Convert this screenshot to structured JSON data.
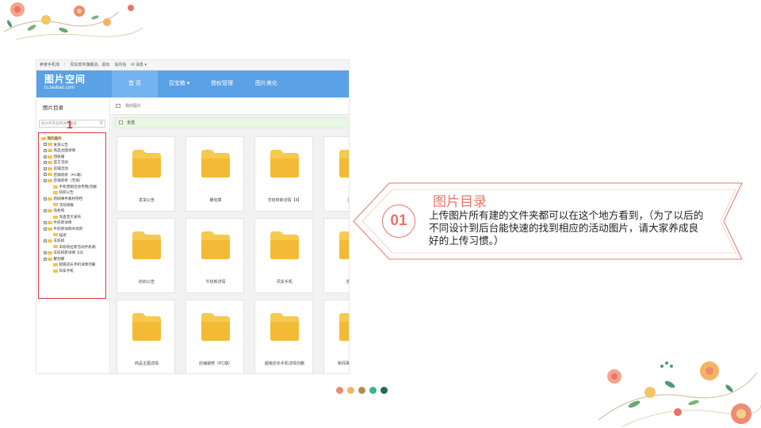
{
  "topbar": {
    "link1": "卖家手机淘",
    "link2": "风车软件旗舰店，退出",
    "link3": "站内信",
    "message": "消息"
  },
  "navbar": {
    "logo_main": "图片空间",
    "logo_sub": "tu.taobao.com",
    "items": [
      "首 页",
      "百宝箱 ▾",
      "授权管理",
      "图片美化"
    ]
  },
  "sidebar": {
    "title": "图片目录",
    "search_placeholder": "按文件夹名称进行搜索",
    "callout_number": "1",
    "tree": [
      {
        "label": "我的图片",
        "level": "root"
      },
      {
        "label": "发货公告",
        "level": "lvl1",
        "expand": true
      },
      {
        "label": "商品主图详情",
        "level": "lvl1",
        "expand": true
      },
      {
        "label": "回收箱",
        "level": "lvl1",
        "expand": true
      },
      {
        "label": "官方活动",
        "level": "lvl1",
        "expand": true
      },
      {
        "label": "店铺活动",
        "level": "lvl1",
        "expand": true
      },
      {
        "label": "店铺装修（PC端）",
        "level": "lvl1",
        "expand": true
      },
      {
        "label": "店铺装修（无线）",
        "level": "lvl1",
        "expand": true
      },
      {
        "label": "手机营销活动专用(勿删",
        "level": "lvl2"
      },
      {
        "label": "纺织公告",
        "level": "lvl2"
      },
      {
        "label": "新闻事件素材存档",
        "level": "lvl1",
        "expand": true
      },
      {
        "label": "活动海报",
        "level": "lvl2"
      },
      {
        "label": "淘抢购",
        "level": "lvl1",
        "expand": true
      },
      {
        "label": "淘直宝贝发布",
        "level": "lvl2"
      },
      {
        "label": "牛纺新详情",
        "level": "lvl1",
        "expand": true
      },
      {
        "label": "牛纺新详情木纹新",
        "level": "lvl1",
        "expand": true
      },
      {
        "label": "描述",
        "level": "lvl2"
      },
      {
        "label": "羊纺校",
        "level": "lvl1",
        "expand": true
      },
      {
        "label": "羊纺校拉新活动手机端",
        "level": "lvl2"
      },
      {
        "label": "羊纺校新详情【4】",
        "level": "lvl1",
        "expand": true
      },
      {
        "label": "聚划算",
        "level": "lvl1",
        "expand": true
      },
      {
        "label": "超级店长手机详情勿删",
        "level": "lvl2"
      },
      {
        "label": "风车手机",
        "level": "lvl2"
      }
    ]
  },
  "main": {
    "breadcrumb": "我的图片",
    "select_all": "全选",
    "folders": [
      "发货公告",
      "聚划算",
      "羊纺校新详情【4】",
      "回收箱",
      "纺织公告",
      "牛纺新详情",
      "风车手机",
      "活动海报",
      "商品主图详情",
      "店铺装修（PC端）",
      "超级店长手机详情勿删",
      "新闻事件素材存档"
    ]
  },
  "callout": {
    "number": "01",
    "title": "图片目录",
    "text": "上传图片所有建的文件夹都可以在这个地方看到，（为了以后的不同设计到后台能快速的找到相应的活动图片，请大家养成良好的上传习惯。）"
  },
  "colors": {
    "accent": "#e8756a",
    "nav_blue": "#5aa1e6",
    "folder_yellow": "#f3c54d",
    "highlight_red": "#d9363e",
    "dots": [
      "#f08a72",
      "#f3b562",
      "#b4894e",
      "#3bb58c",
      "#1e6b4d"
    ]
  }
}
